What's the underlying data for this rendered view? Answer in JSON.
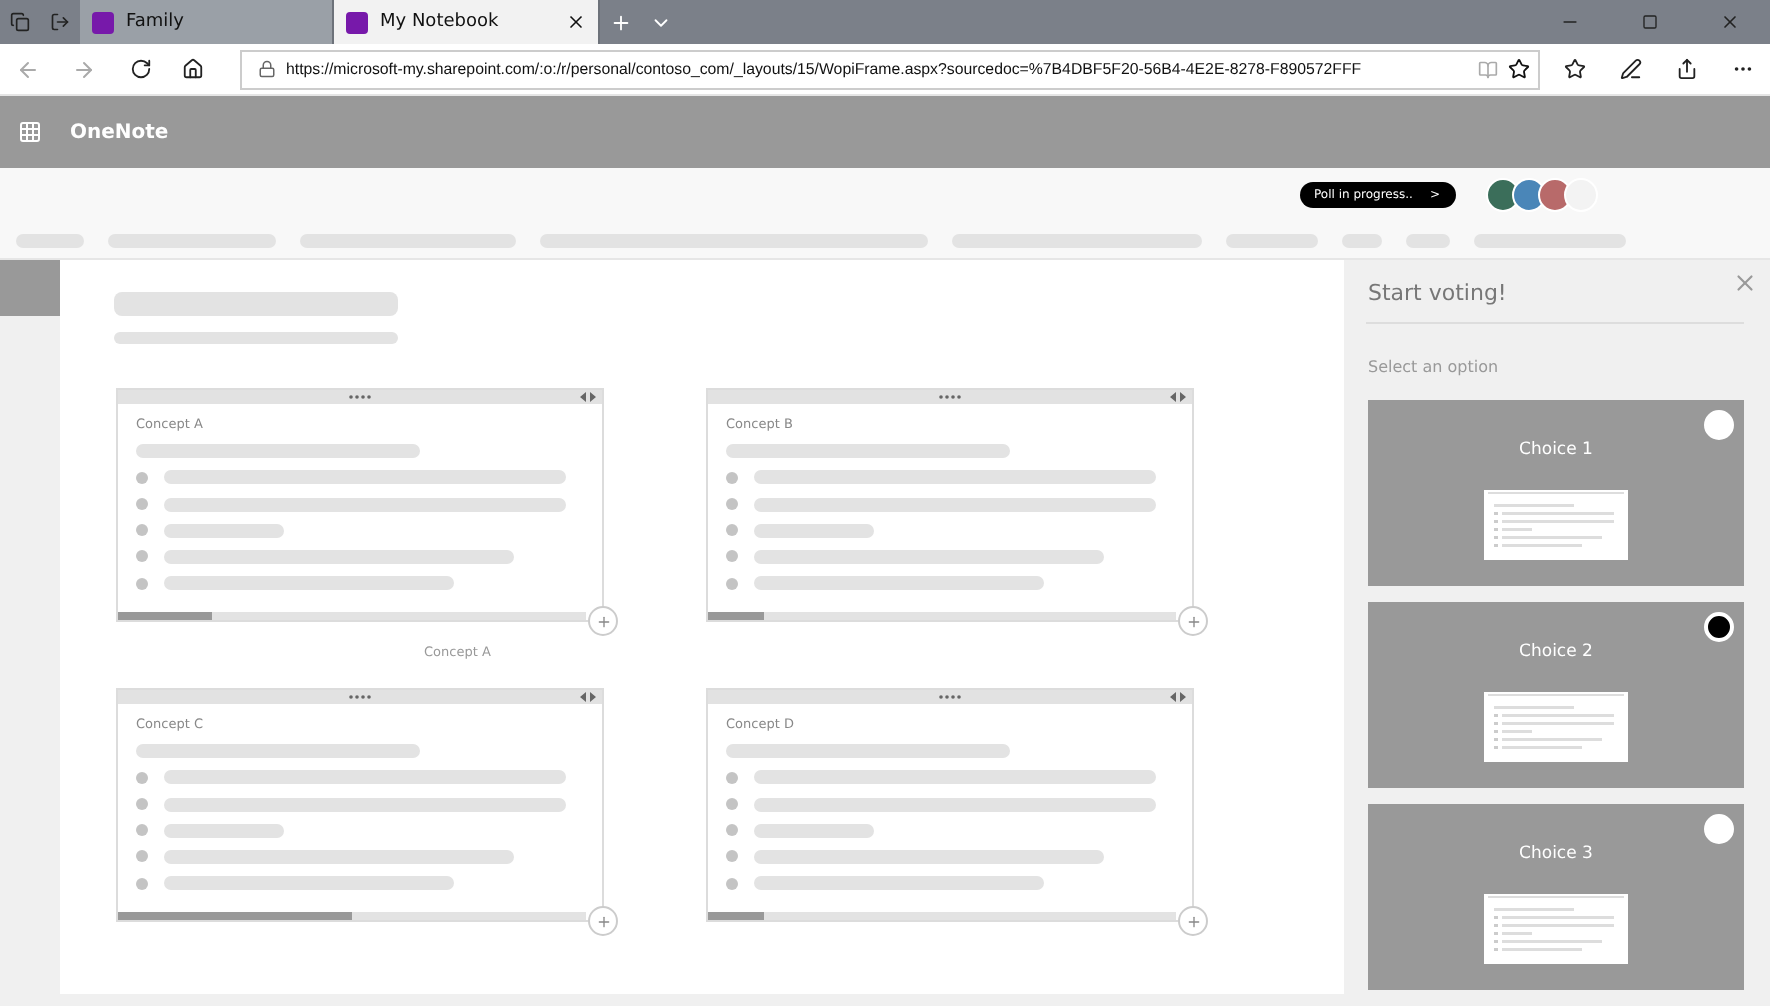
{
  "browser": {
    "tabs": [
      {
        "label": "Family",
        "selected": false
      },
      {
        "label": "My Notebook",
        "selected": true
      }
    ],
    "url": "https://microsoft-my.sharepoint.com/:o:/r/personal/contoso_com/_layouts/15/WopiFrame.aspx?sourcedoc=%7B4DBF5F20-56B4-4E2E-8278-F890572FFF"
  },
  "app": {
    "name": "OneNote"
  },
  "toolbar": {
    "poll_badge": "Poll in progress..",
    "poll_arrow": ">"
  },
  "page": {
    "cards": [
      {
        "title": "Concept A",
        "level": 0.2
      },
      {
        "title": "Concept B",
        "level": 0.12
      },
      {
        "title": "Concept C",
        "level": 0.5
      },
      {
        "title": "Concept D",
        "level": 0.12
      }
    ],
    "caption": "Concept A"
  },
  "panel": {
    "title": "Start voting!",
    "prompt": "Select an option",
    "choices": [
      {
        "label": "Choice 1",
        "selected": false
      },
      {
        "label": "Choice 2",
        "selected": true
      },
      {
        "label": "Choice 3",
        "selected": false
      }
    ]
  }
}
